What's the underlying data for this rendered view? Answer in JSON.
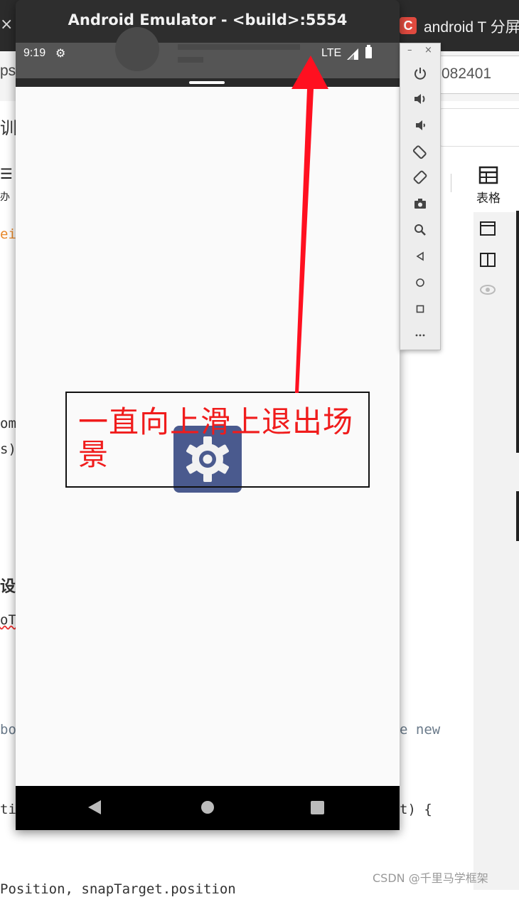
{
  "background": {
    "top_close": "×",
    "tab_icon_letter": "C",
    "tab_title": "android T 分屏",
    "url_left": "ps",
    "url_right": "082401",
    "row2_left": "训练",
    "toolbar_left_icon": "☰",
    "toolbar_left_text": "办",
    "table_label": "表格",
    "code_lines": [
      {
        "text": "ei",
        "style": "orange"
      },
      {
        "text": "om.",
        "style": ""
      },
      {
        "text": "s)",
        "style": ""
      },
      {
        "text": "设置",
        "style": "bold"
      },
      {
        "text": "oT",
        "style": "squiggle"
      },
      {
        "text": "bo",
        "style": "gray"
      },
      {
        "text": "e new",
        "style": "gray"
      },
      {
        "text": "ti",
        "style": ""
      },
      {
        "text": "t) {",
        "style": ""
      },
      {
        "text": "Position, snapTarget.position",
        "style": ""
      }
    ],
    "watermark": "CSDN @千里马学框架"
  },
  "emulator": {
    "title": "Android Emulator - <build>:5554",
    "status_bar": {
      "time": "9:19",
      "network": "LTE",
      "gear_icon": "settings-gear-icon",
      "signal_icon": "signal-icon",
      "battery_icon": "battery-icon"
    },
    "navigation": {
      "back_icon": "back-triangle-icon",
      "home_icon": "home-circle-icon",
      "recents_icon": "recents-square-icon"
    },
    "app_icon": "settings-gear-icon",
    "app_icon_color": "#4a5a8e",
    "side_toolbar": {
      "minimize_label": "–",
      "close_label": "×",
      "buttons": [
        "power-icon",
        "volume-up-icon",
        "volume-down-icon",
        "rotate-left-icon",
        "rotate-right-icon",
        "camera-icon",
        "zoom-icon",
        "back-icon",
        "home-icon",
        "overview-icon",
        "more-icon"
      ]
    }
  },
  "annotation": {
    "text": "一直向上滑上退出场景",
    "color": "#f01c1c",
    "arrow_color": "#ff1020"
  }
}
